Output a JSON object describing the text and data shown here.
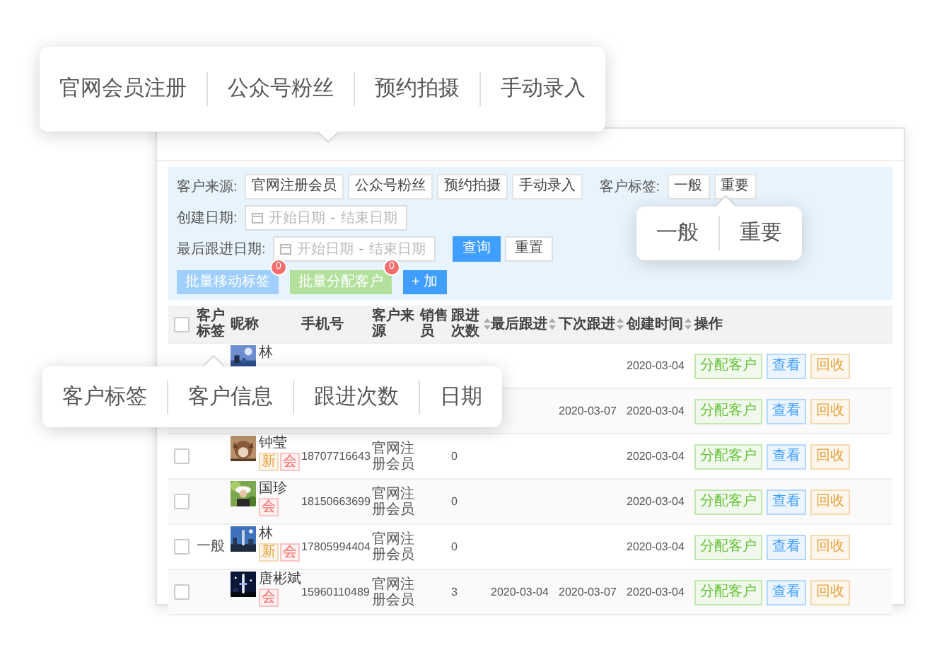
{
  "callouts": [
    {
      "items": [
        "官网会员注册",
        "公众号粉丝",
        "预约拍摄",
        "手动录入"
      ]
    },
    {
      "items": [
        "一般",
        "重要"
      ]
    },
    {
      "items": [
        "客户标签",
        "客户信息",
        "跟进次数",
        "日期"
      ]
    }
  ],
  "filters": {
    "source": {
      "label": "客户来源:",
      "options": [
        {
          "label": "官网注册会员",
          "selected": false
        },
        {
          "label": "公众号粉丝",
          "selected": false
        },
        {
          "label": "预约拍摄",
          "selected": false
        },
        {
          "label": "手动录入",
          "selected": false
        }
      ]
    },
    "tag": {
      "label": "客户标签:",
      "options": [
        {
          "label": "一般",
          "selected": false
        },
        {
          "label": "重要",
          "selected": false
        }
      ]
    },
    "created_date": {
      "label": "创建日期:",
      "start": {
        "placeholder": "开始日期"
      },
      "separator": "-",
      "end": {
        "placeholder": "结束日期"
      }
    },
    "last_follow_date": {
      "label": "最后跟进日期:",
      "start": {
        "placeholder": "开始日期"
      },
      "separator": "-",
      "end": {
        "placeholder": "结束日期"
      }
    },
    "search_button": "查询",
    "reset_button": "重置",
    "bulk_actions": [
      {
        "label": "批量移动标签",
        "kind": "move",
        "badge": "0"
      },
      {
        "label": "批量分配客户",
        "kind": "assign",
        "badge": "0"
      },
      {
        "label": "+ 加",
        "kind": "add"
      }
    ]
  },
  "table": {
    "select_all": {
      "checked": false
    },
    "columns": [
      {
        "label": "客户标签",
        "sortable": false
      },
      {
        "label": "昵称",
        "sortable": false
      },
      {
        "label": "手机号",
        "sortable": false
      },
      {
        "label": "客户来源",
        "sortable": false
      },
      {
        "label": "销售员",
        "sortable": false
      },
      {
        "label": "跟进次数",
        "sortable": true
      },
      {
        "label": "最后跟进",
        "sortable": true
      },
      {
        "label": "下次跟进",
        "sortable": true
      },
      {
        "label": "创建时间",
        "sortable": true
      },
      {
        "label": "操作",
        "sortable": false
      }
    ],
    "rows": [
      {
        "avatar": {
          "kind": "picture"
        },
        "name": "林",
        "created": "2020-03-04",
        "actions": [
          {
            "label": "分配客户",
            "kind": "assign"
          },
          {
            "label": "查看",
            "kind": "view"
          },
          {
            "label": "回收",
            "kind": "recycle"
          }
        ]
      },
      {
        "next": "2020-03-07",
        "created": "2020-03-04",
        "actions": [
          {
            "label": "分配客户",
            "kind": "assign"
          },
          {
            "label": "查看",
            "kind": "view"
          },
          {
            "label": "回收",
            "kind": "recycle"
          }
        ]
      },
      {
        "checked": false,
        "avatar": {
          "kind": "picture"
        },
        "name": "钟莹",
        "badges": [
          {
            "label": "新",
            "kind": "new"
          },
          {
            "label": "会",
            "kind": "member"
          }
        ],
        "phone": "18707716643",
        "source": "官网注册会员",
        "follow_count": "0",
        "created": "2020-03-04",
        "actions": [
          {
            "label": "分配客户",
            "kind": "assign"
          },
          {
            "label": "查看",
            "kind": "view"
          },
          {
            "label": "回收",
            "kind": "recycle"
          }
        ]
      },
      {
        "checked": false,
        "avatar": {
          "kind": "picture"
        },
        "name": "国珍",
        "badges": [
          {
            "label": "会",
            "kind": "member"
          }
        ],
        "phone": "18150663699",
        "source": "官网注册会员",
        "follow_count": "0",
        "created": "2020-03-04",
        "actions": [
          {
            "label": "分配客户",
            "kind": "assign"
          },
          {
            "label": "查看",
            "kind": "view"
          },
          {
            "label": "回收",
            "kind": "recycle"
          }
        ]
      },
      {
        "checked": false,
        "tag": "一般",
        "avatar": {
          "kind": "picture"
        },
        "name": "林",
        "badges": [
          {
            "label": "新",
            "kind": "new"
          },
          {
            "label": "会",
            "kind": "member"
          }
        ],
        "phone": "17805994404",
        "source": "官网注册会员",
        "follow_count": "0",
        "created": "2020-03-04",
        "actions": [
          {
            "label": "分配客户",
            "kind": "assign"
          },
          {
            "label": "查看",
            "kind": "view"
          },
          {
            "label": "回收",
            "kind": "recycle"
          }
        ]
      },
      {
        "checked": false,
        "avatar": {
          "kind": "picture"
        },
        "name": "唐彬斌",
        "badges": [
          {
            "label": "会",
            "kind": "member"
          }
        ],
        "phone": "15960110489",
        "source": "官网注册会员",
        "follow_count": "3",
        "last": "2020-03-04",
        "next": "2020-03-07",
        "created": "2020-03-04",
        "actions": [
          {
            "label": "分配客户",
            "kind": "assign"
          },
          {
            "label": "查看",
            "kind": "view"
          },
          {
            "label": "回收",
            "kind": "recycle"
          }
        ]
      }
    ]
  }
}
